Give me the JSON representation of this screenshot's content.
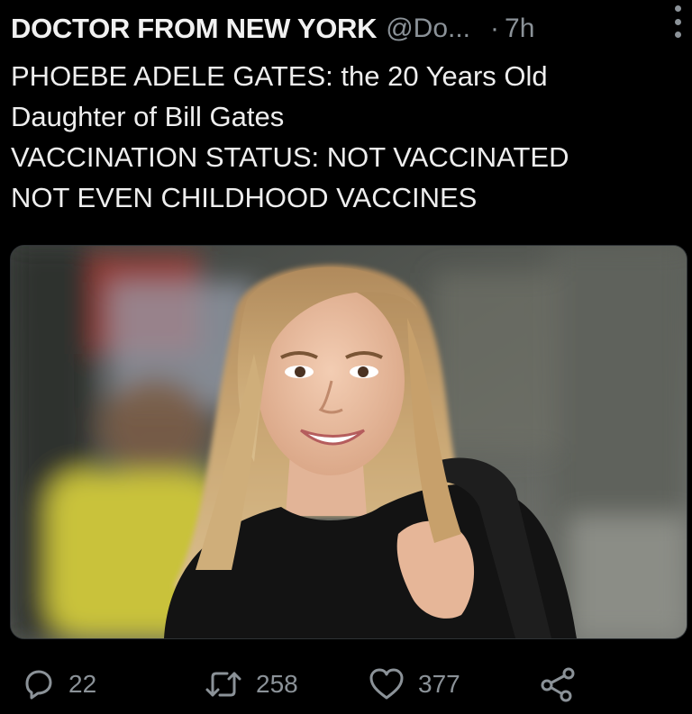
{
  "tweet": {
    "author_name": "DOCTOR FROM NEW YORK",
    "handle": "@Do...",
    "separator": "·",
    "time": "7h",
    "lines": [
      "PHOEBE ADELE GATES: the 20 Years Old",
      "Daughter of Bill Gates",
      "VACCINATION STATUS: NOT VACCINATED",
      "NOT EVEN CHILDHOOD VACCINES"
    ]
  },
  "actions": {
    "replies": "22",
    "retweets": "258",
    "likes": "377"
  },
  "icons": {
    "more": "more-options-icon",
    "reply": "reply-bubble-icon",
    "retweet": "retweet-icon",
    "like": "heart-icon",
    "share": "share-icon"
  },
  "colors": {
    "background": "#000000",
    "text": "#e7e9ea",
    "muted": "#8b9298"
  }
}
